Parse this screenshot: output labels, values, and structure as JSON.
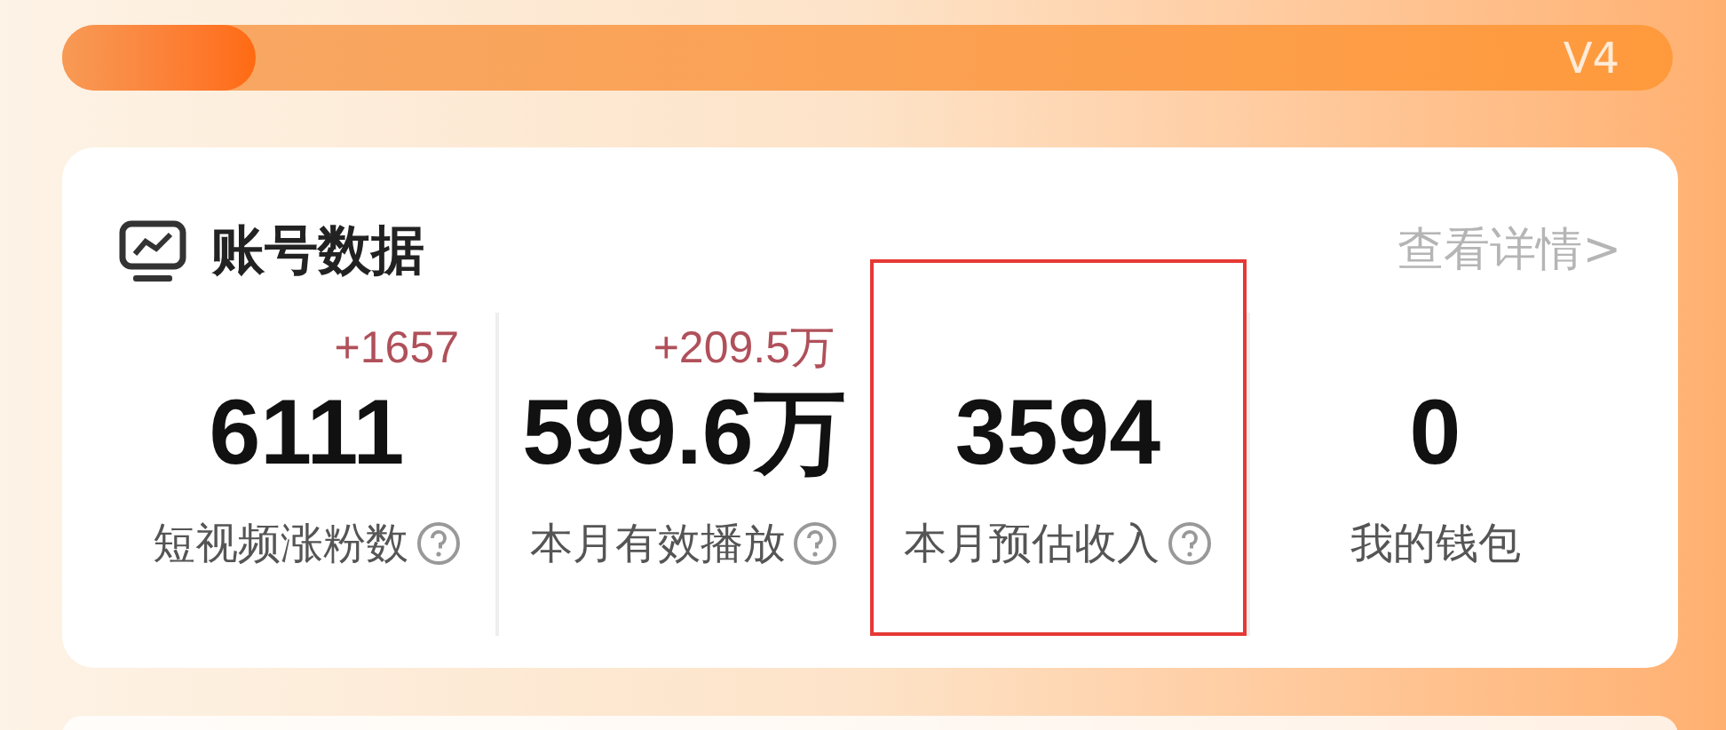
{
  "level_bar": {
    "level": 0.12,
    "label": "V4"
  },
  "card": {
    "title": "账号数据",
    "link": "查看详情>",
    "stats": [
      {
        "delta": "+1657",
        "value": "6111",
        "label": "短视频涨粉数",
        "help": true,
        "highlighted": false
      },
      {
        "delta": "+209.5万",
        "value": "599.6万",
        "label": "本月有效播放",
        "help": true,
        "highlighted": false
      },
      {
        "value": "3594",
        "label": "本月预估收入",
        "help": true,
        "highlighted": true
      },
      {
        "value": "0",
        "label": "我的钱包",
        "help": false,
        "highlighted": false
      }
    ]
  }
}
